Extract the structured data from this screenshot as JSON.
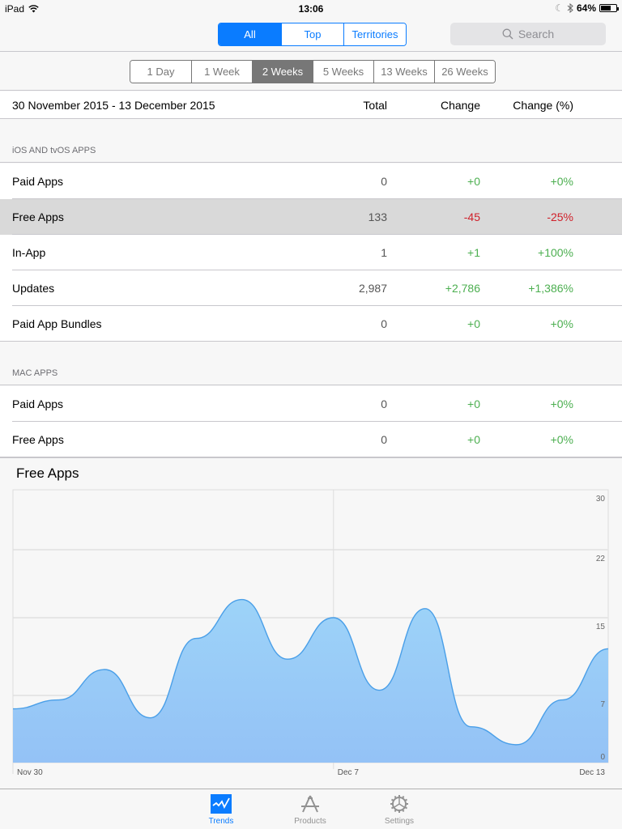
{
  "status_bar": {
    "device": "iPad",
    "time": "13:06",
    "battery": "64%",
    "battery_level": 0.64
  },
  "nav": {
    "segments": [
      {
        "label": "All",
        "active": true
      },
      {
        "label": "Top",
        "active": false
      },
      {
        "label": "Territories",
        "active": false
      }
    ],
    "search_placeholder": "Search"
  },
  "periods": [
    {
      "label": "1 Day",
      "active": false
    },
    {
      "label": "1 Week",
      "active": false
    },
    {
      "label": "2 Weeks",
      "active": true
    },
    {
      "label": "5 Weeks",
      "active": false
    },
    {
      "label": "13 Weeks",
      "active": false
    },
    {
      "label": "26 Weeks",
      "active": false
    }
  ],
  "table_header": {
    "date_range": "30 November 2015 - 13 December 2015",
    "total": "Total",
    "change": "Change",
    "change_pct": "Change (%)"
  },
  "sections": [
    {
      "title": "iOS AND tvOS APPS",
      "rows": [
        {
          "label": "Paid Apps",
          "total": "0",
          "change": "+0",
          "change_pct": "+0%",
          "trend": "pos",
          "selected": false
        },
        {
          "label": "Free Apps",
          "total": "133",
          "change": "-45",
          "change_pct": "-25%",
          "trend": "neg",
          "selected": true
        },
        {
          "label": "In-App",
          "total": "1",
          "change": "+1",
          "change_pct": "+100%",
          "trend": "pos",
          "selected": false
        },
        {
          "label": "Updates",
          "total": "2,987",
          "change": "+2,786",
          "change_pct": "+1,386%",
          "trend": "pos",
          "selected": false
        },
        {
          "label": "Paid App Bundles",
          "total": "0",
          "change": "+0",
          "change_pct": "+0%",
          "trend": "pos",
          "selected": false
        }
      ]
    },
    {
      "title": "MAC APPS",
      "rows": [
        {
          "label": "Paid Apps",
          "total": "0",
          "change": "+0",
          "change_pct": "+0%",
          "trend": "pos",
          "selected": false
        },
        {
          "label": "Free Apps",
          "total": "0",
          "change": "+0",
          "change_pct": "+0%",
          "trend": "pos",
          "selected": false
        }
      ]
    }
  ],
  "chart_data": {
    "type": "area",
    "title": "Free Apps",
    "x": [
      "Nov 30",
      "Dec 1",
      "Dec 2",
      "Dec 3",
      "Dec 4",
      "Dec 5",
      "Dec 6",
      "Dec 7",
      "Dec 8",
      "Dec 9",
      "Dec 10",
      "Dec 11",
      "Dec 12",
      "Dec 13"
    ],
    "values": [
      6,
      7,
      10,
      5,
      13,
      17,
      11,
      15,
      8,
      16,
      4,
      2,
      7,
      12
    ],
    "x_tick_labels": [
      "Nov 30",
      "Dec 7",
      "Dec 13"
    ],
    "y_tick_labels": [
      "0",
      "7",
      "15",
      "22",
      "30"
    ],
    "y_ticks": [
      0,
      7.5,
      15,
      22.5,
      30
    ],
    "ylim": [
      0,
      30
    ],
    "xlabel": "",
    "ylabel": "",
    "grid": true,
    "y_axis_side": "right",
    "line_color": "#4a9fe8",
    "fill_color_top": "#9dd3f8",
    "fill_color_bottom": "#94c2f6"
  },
  "tabs": [
    {
      "label": "Trends",
      "icon": "trends-icon",
      "active": true
    },
    {
      "label": "Products",
      "icon": "products-icon",
      "active": false
    },
    {
      "label": "Settings",
      "icon": "settings-icon",
      "active": false
    }
  ],
  "colors": {
    "accent": "#0a7cff",
    "positive": "#4caf50",
    "negative": "#d0202a",
    "selected_row": "#d9d9d9"
  }
}
